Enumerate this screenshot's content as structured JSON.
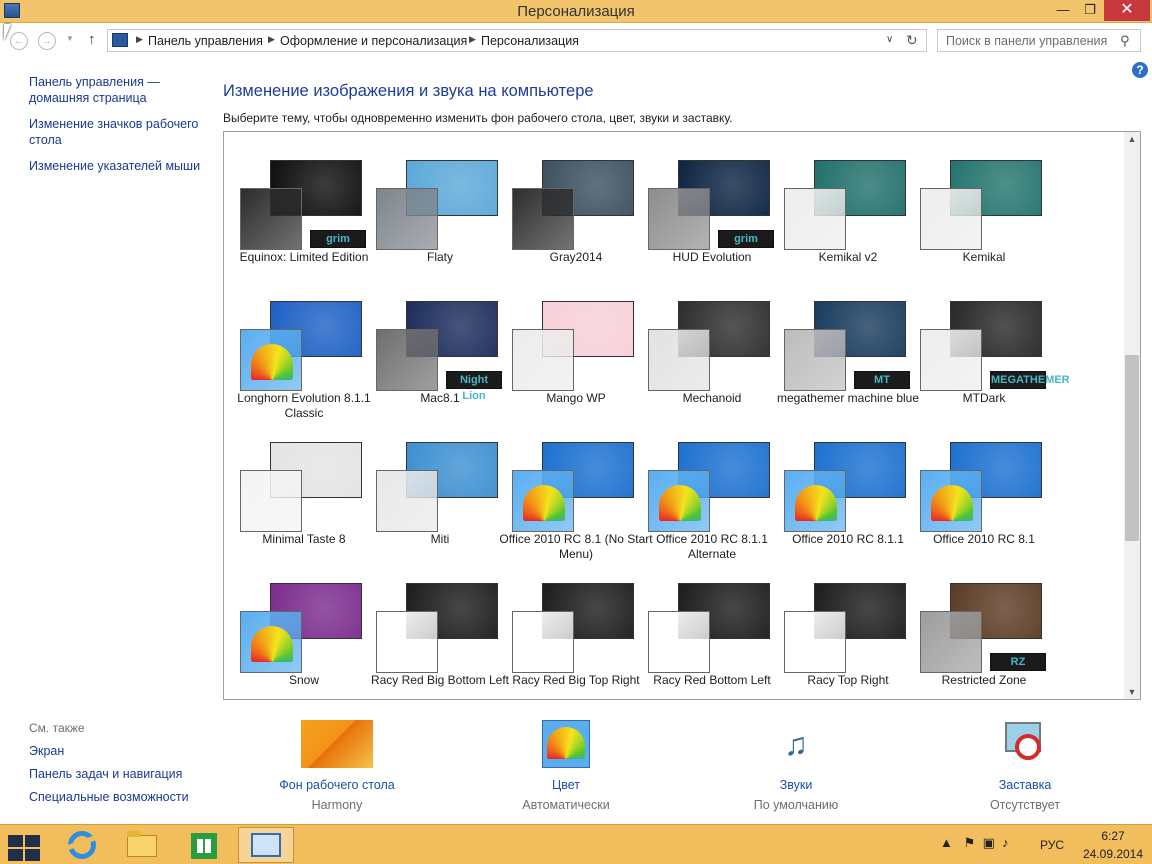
{
  "window": {
    "title": "Персонализация",
    "min_glyph": "—",
    "max_glyph": "❐",
    "close_glyph": "✕"
  },
  "address": {
    "crumbs": [
      "Панель управления",
      "Оформление и персонализация",
      "Персонализация"
    ],
    "search_placeholder": "Поиск в панели управления"
  },
  "sidebar": {
    "items": [
      {
        "label": "Панель управления — домашняя страница"
      },
      {
        "label": "Изменение значков рабочего стола"
      },
      {
        "label": "Изменение указателей мыши"
      }
    ]
  },
  "main": {
    "heading": "Изменение изображения и звука на компьютере",
    "subheading": "Выберите тему, чтобы одновременно изменить фон рабочего стола, цвет, звуки и заставку."
  },
  "themes": [
    {
      "name": "Equinox: Limited Edition",
      "bg": "#0c0c0c",
      "fg": "#2c2c2c",
      "badge": "grim"
    },
    {
      "name": "Flaty",
      "bg": "#5aa7d8",
      "fg": "#7f858c"
    },
    {
      "name": "Gray2014",
      "bg": "#3a4f5e",
      "fg": "#2e2e2e"
    },
    {
      "name": "HUD Evolution",
      "bg": "#0a2240",
      "fg": "#8d8d8d",
      "badge": "grim"
    },
    {
      "name": "Kemikal v2",
      "bg": "#1f6f6a",
      "fg": "#ededed"
    },
    {
      "name": "Kemikal",
      "bg": "#22736d",
      "fg": "#ededed"
    },
    {
      "name": "Longhorn Evolution 8.1.1 Classic",
      "bg": "#1b5fc4",
      "fg": "#5aaef0",
      "fan": true
    },
    {
      "name": "Mac8.1",
      "bg": "#1a2a5a",
      "fg": "#6f6f6f",
      "badge": "Night Lion"
    },
    {
      "name": "Mango WP",
      "bg": "#f7cfd7",
      "fg": "#ececec"
    },
    {
      "name": "Mechanoid",
      "bg": "#2b2b2b",
      "fg": "#e2e2e2"
    },
    {
      "name": "megathemer machine blue",
      "bg": "#173a5c",
      "fg": "#bcbcbc",
      "badge": "MT"
    },
    {
      "name": "MTDark",
      "bg": "#262626",
      "fg": "#ededed",
      "badge": "MEGATHEMER"
    },
    {
      "name": "Minimal Taste 8",
      "bg": "#e4e4e4",
      "fg": "#f4f4f4"
    },
    {
      "name": "Miti",
      "bg": "#3b8ed0",
      "fg": "#e8e8e8"
    },
    {
      "name": "Office 2010 RC 8.1 (No Start Menu)",
      "bg": "#1a6fcf",
      "fg": "#5aaef0",
      "fan": true
    },
    {
      "name": "Office 2010 RC 8.1.1 Alternate",
      "bg": "#1a6fcf",
      "fg": "#5aaef0",
      "fan": true
    },
    {
      "name": "Office 2010 RC 8.1.1",
      "bg": "#1a6fcf",
      "fg": "#5aaef0",
      "fan": true
    },
    {
      "name": "Office 2010 RC 8.1",
      "bg": "#1a6fcf",
      "fg": "#5aaef0",
      "fan": true
    },
    {
      "name": "Snow",
      "bg": "#7a2a8c",
      "fg": "#5aaef0",
      "fan": true
    },
    {
      "name": "Racy Red Big Bottom Left",
      "bg": "#1a1a1a",
      "fg": "#ffffff"
    },
    {
      "name": "Racy Red Big Top Right",
      "bg": "#1a1a1a",
      "fg": "#ffffff"
    },
    {
      "name": "Racy Red Bottom Left",
      "bg": "#1a1a1a",
      "fg": "#ffffff"
    },
    {
      "name": "Racy Top Right",
      "bg": "#1a1a1a",
      "fg": "#ffffff"
    },
    {
      "name": "Restricted Zone",
      "bg": "#5a3a22",
      "fg": "#9d9d9d",
      "badge": "RZ"
    }
  ],
  "see_also": {
    "title": "См. также",
    "links": [
      "Экран",
      "Панель задач и навигация",
      "Специальные возможности"
    ]
  },
  "tools": [
    {
      "label": "Фон рабочего стола",
      "value": "Harmony",
      "icon": "desktop-background-icon"
    },
    {
      "label": "Цвет",
      "value": "Автоматически",
      "icon": "color-icon"
    },
    {
      "label": "Звуки",
      "value": "По умолчанию",
      "icon": "sounds-icon"
    },
    {
      "label": "Заставка",
      "value": "Отсутствует",
      "icon": "screensaver-icon"
    }
  ],
  "taskbar": {
    "lang": "РУС",
    "time": "6:27",
    "date": "24.09.2014"
  },
  "colors": {
    "titlebar": "#f2c46b",
    "taskbar": "#f2bd5c",
    "link": "#1a3a8f",
    "heading": "#1d3d9a"
  }
}
